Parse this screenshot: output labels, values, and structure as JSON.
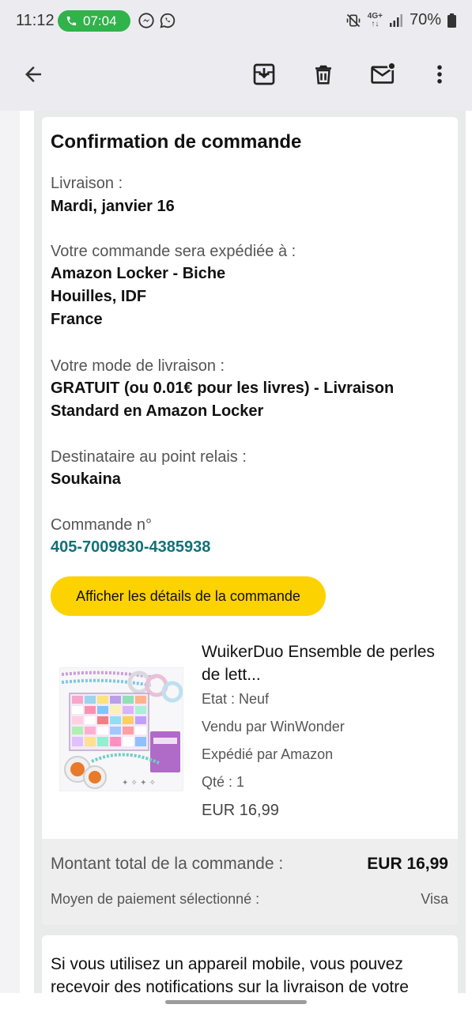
{
  "status_bar": {
    "time": "11:12",
    "call_timer": "07:04",
    "network_badge_top": "4G+",
    "battery": "70%"
  },
  "email": {
    "title": "Confirmation de commande",
    "delivery_label": "Livraison :",
    "delivery_date": "Mardi, janvier 16",
    "ship_to_label": "Votre commande sera expédiée à :",
    "ship_to_line1": "Amazon Locker - Biche",
    "ship_to_line2": "Houilles, IDF",
    "ship_to_line3": "France",
    "mode_label": "Votre mode de livraison :",
    "mode_line1": "GRATUIT (ou 0.01€ pour les livres) - Livraison",
    "mode_line2": "Standard en Amazon Locker",
    "recipient_label": "Destinataire au point relais :",
    "recipient_name": "Soukaina",
    "order_label": "Commande n°",
    "order_number": "405-7009830-4385938",
    "details_button": "Afficher les détails de la commande",
    "product": {
      "title": "WuikerDuo Ensemble de perles de lett...",
      "condition": "Etat : Neuf",
      "sold_by": "Vendu par WinWonder",
      "shipped_by": "Expédié par Amazon",
      "quantity": "Qté : 1",
      "price": "EUR 16,99"
    },
    "total_label": "Montant total de la commande :",
    "total_value": "EUR 16,99",
    "payment_label": "Moyen de paiement sélectionné :",
    "payment_value": "Visa",
    "mobile_notice": "Si vous utilisez un appareil mobile, vous pouvez recevoir des notifications sur la livraison de votre"
  },
  "icons": {
    "back": "arrow-back-icon",
    "archive": "archive-icon",
    "delete": "trash-icon",
    "mark_unread": "mail-unread-icon",
    "more": "more-vert-icon"
  },
  "colors": {
    "call_pill": "#2fb34a",
    "button_yellow": "#fcd200",
    "order_link": "#127078"
  }
}
